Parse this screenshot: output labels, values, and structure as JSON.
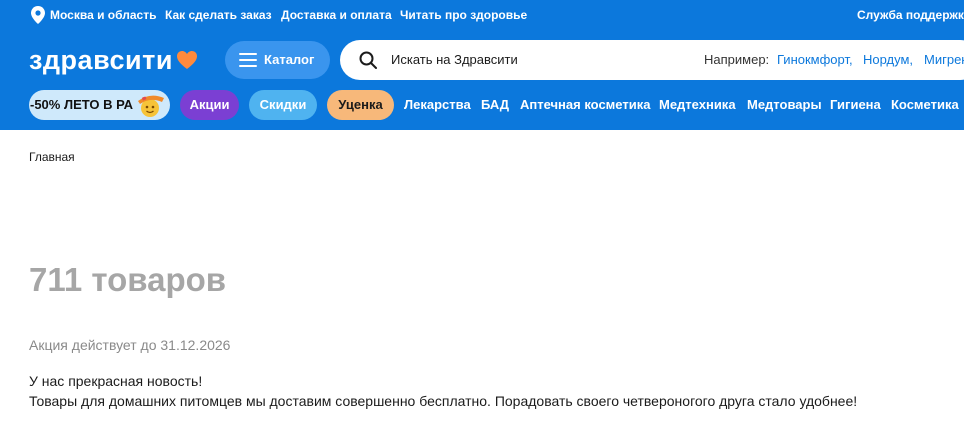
{
  "colors": {
    "brand_blue": "#0c78dc",
    "catalog_button": "#3a95ee",
    "akcii_pill": "#7b3fd3",
    "skidki_pill": "#4fb3f0",
    "ucenka_pill": "#f7b87a",
    "logo_heart": "#ff8a3d",
    "promo_pill_bg": "#cfe9fb",
    "muted_text": "#a6a6a6"
  },
  "topbar": {
    "region_icon": "location-pin-icon",
    "region": "Москва и область",
    "links": [
      "Как сделать заказ",
      "Доставка и оплата",
      "Читать про здоровье"
    ],
    "support": "Служба поддержки"
  },
  "header": {
    "logo_text": "здравсити",
    "logo_icon": "heart-icon",
    "catalog_icon": "hamburger-menu-icon",
    "catalog_label": "Каталог",
    "search": {
      "icon": "search-icon",
      "placeholder": "Искать на Здравсити",
      "examples_label": "Например:",
      "examples": [
        "Гинокмфорт,",
        "Нордум,",
        "Мигрен"
      ]
    }
  },
  "categories": {
    "promo_label": "-50% ЛЕТО В РА",
    "promo_icon": "sun-sticker-icon",
    "pills": [
      "Акции",
      "Скидки",
      "Уценка"
    ],
    "links": [
      "Лекарства",
      "БАД",
      "Аптечная косметика",
      "Медтехника",
      "Медтовары",
      "Гигиена",
      "Косметика"
    ]
  },
  "main": {
    "breadcrumb": "Главная",
    "products_count": "711 товаров",
    "valid_until": "Акция действует до 31.12.2026",
    "news_line1": "У нас прекрасная новость!",
    "news_line2": "Товары для домашних питомцев мы доставим совершенно бесплатно. Порадовать своего четвероногого друга стало удобнее!"
  }
}
